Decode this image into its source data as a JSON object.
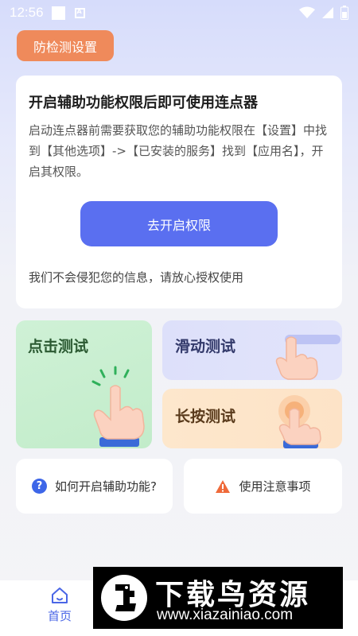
{
  "status_bar": {
    "time": "12:56",
    "notification_icon": "A"
  },
  "header": {
    "anti_detect_label": "防检测设置"
  },
  "permission_card": {
    "title": "开启辅助功能权限后即可使用连点器",
    "description": "启动连点器前需要获取您的辅助功能权限在【设置】中找到【其他选项】->【已安装的服务】找到【应用名】，开启其权限。",
    "button_label": "去开启权限",
    "note": "我们不会侵犯您的信息，请放心授权使用"
  },
  "tests": {
    "click_test": "点击测试",
    "swipe_test": "滑动测试",
    "long_press_test": "长按测试"
  },
  "help": {
    "how_to_enable": "如何开启辅助功能?",
    "precautions": "使用注意事项"
  },
  "tabbar": {
    "home_label": "首页"
  },
  "watermark": {
    "title": "下载鸟资源",
    "url": "www.xiazainiao.com"
  },
  "colors": {
    "accent": "#5a6ff0",
    "orange": "#ef8a5b",
    "warning": "#ef6a3a",
    "help_blue": "#3d66e8"
  }
}
